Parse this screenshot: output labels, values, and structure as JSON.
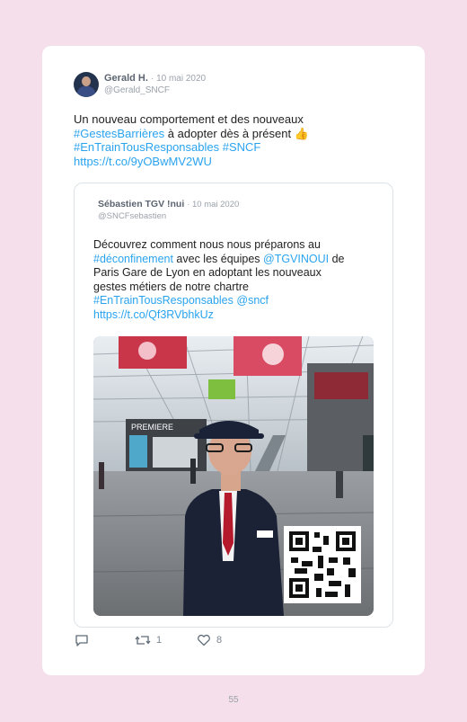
{
  "tweet": {
    "author_name": "Gerald H.",
    "date": "10 mai 2020",
    "handle": "@Gerald_SNCF",
    "text_line1": "Un nouveau comportement et des nouveaux",
    "hashtag_gestes": "#GestesBarrières",
    "text_line2": " à adopter dès à présent ",
    "emoji": "👍",
    "hashtag_entrain": "#EnTrainTousResponsables",
    "hashtag_sncf": "#SNCF",
    "url": "https://t.co/9yOBwMV2WU"
  },
  "quoted": {
    "author_name": "Sébastien TGV !nui",
    "date": "10 mai 2020",
    "handle": "@SNCFsebastien",
    "line1": "Découvrez comment nous nous préparons au",
    "hashtag_deconfinement": "#déconfinement",
    "line2a": " avec les équipes ",
    "mention_tgv": "@TGVINOUI",
    "line2b": " de",
    "line3": "Paris Gare de Lyon en adoptant les nouveaux",
    "line4": "gestes métiers de notre chartre",
    "hashtag_entrain": "#EnTrainTousResponsables",
    "mention_sncf": "@sncf",
    "url": "https://t.co/Qf3RVbhkUz",
    "media": {
      "sign_premiere": "PREMIERE"
    }
  },
  "actions": {
    "retweet_count": "1",
    "like_count": "8"
  },
  "footer": {
    "page_number": "55"
  },
  "colors": {
    "background": "#f4dfea",
    "link": "#2aa3ef",
    "text": "#222222",
    "muted": "#9aa2ab"
  }
}
